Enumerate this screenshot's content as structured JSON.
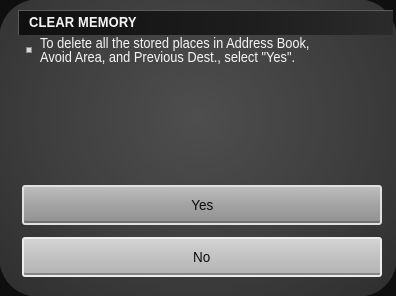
{
  "dialog": {
    "title": "CLEAR MEMORY",
    "message": "To delete all the stored places in Address Book,\nAvoid Area, and Previous Dest., select \"Yes\"."
  },
  "buttons": {
    "yes_label": "Yes",
    "no_label": "No"
  },
  "colors": {
    "background": "#3e3e3e",
    "title_bar": "#101010",
    "yes_button": "#a3a3a3",
    "no_button": "#c2c2c2"
  }
}
